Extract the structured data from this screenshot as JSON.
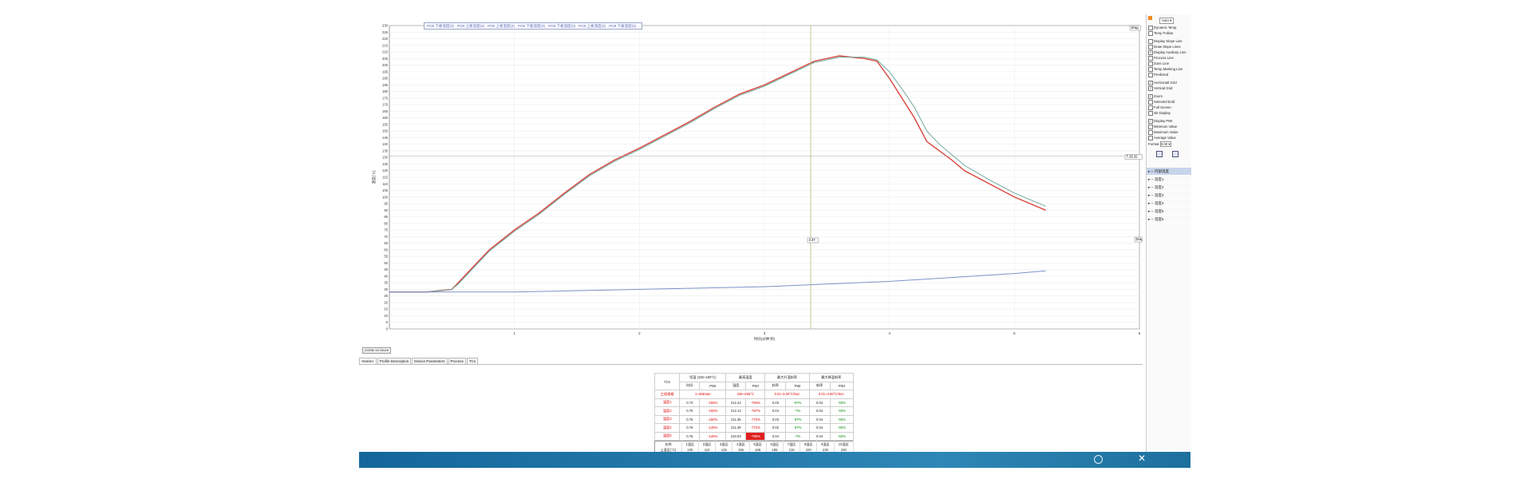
{
  "legend_strip": [
    "PCB 下板温度(3)",
    "PCB 上板温度(4)",
    "PCB 上板温度(4)",
    "PCB 下板温度(3)",
    "PCB 下板温度(3)",
    "PCB 上板温度(4)",
    "PCB 下板温度(3)"
  ],
  "chart": {
    "y_label": "温度(°C)",
    "x_label": "时间(分钟:秒)",
    "x_ticks": [
      "1",
      "2",
      "3",
      "4",
      "5",
      "6"
    ],
    "y_min": 0,
    "y_max": 230,
    "y_step": 5,
    "x_min": 0,
    "x_max": 6,
    "cursor_time": "3.37",
    "right_readout": "T 25.32",
    "marker_left": "Drag",
    "marker_right": "Drag",
    "colors": {
      "red": "#d9443b",
      "teal": "#6fa89f",
      "blue": "#7b92c6",
      "grid": "#e5e5e5",
      "cursor": "#b4b878"
    }
  },
  "chart_data": {
    "type": "line",
    "xlabel": "时间(分钟:秒)",
    "ylabel": "温度(°C)",
    "xlim": [
      0,
      6
    ],
    "ylim": [
      0,
      230
    ],
    "grid": true,
    "series": [
      {
        "name": "温度1",
        "x": [
          0,
          0.3,
          0.5,
          0.55,
          0.65,
          0.8,
          1.0,
          1.2,
          1.4,
          1.6,
          1.8,
          2.0,
          2.2,
          2.4,
          2.6,
          2.8,
          3.0,
          3.2,
          3.4,
          3.6,
          3.8,
          3.9,
          4.0,
          4.1,
          4.2,
          4.3,
          4.4,
          4.5,
          4.6,
          4.8,
          5.0,
          5.2,
          5.25
        ],
        "y": [
          28,
          28,
          30,
          35,
          45,
          60,
          75,
          88,
          103,
          117,
          128,
          137,
          147,
          157,
          168,
          178,
          185,
          194,
          203,
          207,
          205,
          203,
          190,
          175,
          160,
          142,
          135,
          128,
          120,
          110,
          100,
          92,
          90
        ]
      },
      {
        "name": "温度2",
        "x": [
          0,
          0.3,
          0.5,
          0.55,
          0.65,
          0.8,
          1.0,
          1.2,
          1.4,
          1.6,
          1.8,
          2.0,
          2.2,
          2.4,
          2.6,
          2.8,
          3.0,
          3.2,
          3.4,
          3.6,
          3.8,
          3.9,
          4.0,
          4.1,
          4.2,
          4.3,
          4.4,
          4.5,
          4.6,
          4.8,
          5.0,
          5.2,
          5.25
        ],
        "y": [
          28,
          28,
          30,
          34,
          44,
          59,
          74,
          87,
          102,
          116,
          127,
          136,
          146,
          156,
          167,
          177,
          184,
          193,
          202,
          206,
          206,
          204,
          195,
          182,
          168,
          150,
          140,
          132,
          124,
          113,
          103,
          95,
          93
        ]
      },
      {
        "name": "温度3",
        "x": [
          0,
          1,
          2,
          3,
          4,
          5,
          5.25
        ],
        "y": [
          28,
          28,
          30,
          32,
          36,
          42,
          44
        ]
      }
    ]
  },
  "readout_button": "ZOOM 1X Grid",
  "tabs": [
    "Statistic",
    "Profile Description",
    "Device Parameters",
    "Process",
    "TCs"
  ],
  "stats": {
    "hdr1": [
      "TCs",
      "恒温 (150~180°C)",
      "最高温度",
      "最大升温斜率",
      "最大降温斜率"
    ],
    "hdr2": [
      "时间",
      "PWI",
      "温度",
      "PWI",
      "斜率",
      "PWI",
      "斜率",
      "PWI"
    ],
    "limits": [
      "工程规格",
      "1~2Minute",
      "245~255°C",
      "0.01~3.00°C/Sec",
      "0.01~3.00°C/Sec"
    ],
    "rows": [
      {
        "tc": "温度1",
        "t": "0.74",
        "p1": "-155%",
        "temp": "212.22",
        "p2": "-794%",
        "up": "0.03",
        "p3": "-97%",
        "dn": "0.04",
        "p4": "-93%"
      },
      {
        "tc": "温度2",
        "t": "0.75",
        "p1": "-150%",
        "temp": "212.13",
        "p2": "-757%",
        "up": "0.04",
        "p3": "-7%",
        "dn": "0.04",
        "p4": "-93%"
      },
      {
        "tc": "温度3",
        "t": "0.75",
        "p1": "-150%",
        "temp": "211.35",
        "p2": "-772%",
        "up": "0.03",
        "p3": "-97%",
        "dn": "0.04",
        "p4": "-93%"
      },
      {
        "tc": "温度4",
        "t": "0.76",
        "p1": "-145%",
        "temp": "211.36",
        "p2": "-772%",
        "up": "0.02",
        "p3": "-97%",
        "dn": "0.04",
        "p4": "-93%"
      },
      {
        "tc": "温度5",
        "t": "0.76",
        "p1": "-145%",
        "temp": "210.03",
        "p2": "-796%",
        "up": "0.04",
        "p3": "-7%",
        "dn": "0.04",
        "p4": "-93%"
      }
    ]
  },
  "zones": {
    "header": [
      "名称",
      "1温区",
      "2温区",
      "3温区",
      "4温区",
      "5温区",
      "6温区",
      "7温区",
      "8温区",
      "9温区",
      "10温区"
    ],
    "upper": [
      "上温区(°C)",
      "100",
      "110",
      "135",
      "155",
      "165",
      "185",
      "210",
      "220",
      "230",
      "230"
    ],
    "lower": [
      "下温区(°C)",
      "100",
      "110",
      "135",
      "155",
      "165",
      "185",
      "210",
      "220",
      "230",
      "230"
    ]
  },
  "right_panel": {
    "auto_label": "Auto",
    "options": [
      {
        "label": "Dynamic Temp",
        "on": false
      },
      {
        "label": "Temp Follow",
        "on": false
      },
      {
        "label": "Display Slope Line",
        "on": false
      },
      {
        "label": "Draw Slope Lines",
        "on": false
      },
      {
        "label": "Display Auxiliary Line",
        "on": true
      },
      {
        "label": "Process Line",
        "on": false
      },
      {
        "label": "Zone Line",
        "on": false
      },
      {
        "label": "Temp Marking Line",
        "on": false
      },
      {
        "label": "Predicted",
        "on": false
      },
      {
        "label": "Horizontal Grid",
        "on": true
      },
      {
        "label": "Vertical Grid",
        "on": true
      },
      {
        "label": "Zoom",
        "on": true
      },
      {
        "label": "Selected bold",
        "on": false
      },
      {
        "label": "Full Screen",
        "on": false
      },
      {
        "label": "3D Display",
        "on": false
      },
      {
        "label": "Display PWI",
        "on": true
      },
      {
        "label": "Minimum Value",
        "on": false
      },
      {
        "label": "Maximum Value",
        "on": false
      },
      {
        "label": "Average Value",
        "on": false
      }
    ],
    "format_label": "Format",
    "format_value": "0.00",
    "series": [
      "内部温度",
      "温度1",
      "温度2",
      "温度3",
      "温度4",
      "温度5",
      "温度6"
    ]
  }
}
